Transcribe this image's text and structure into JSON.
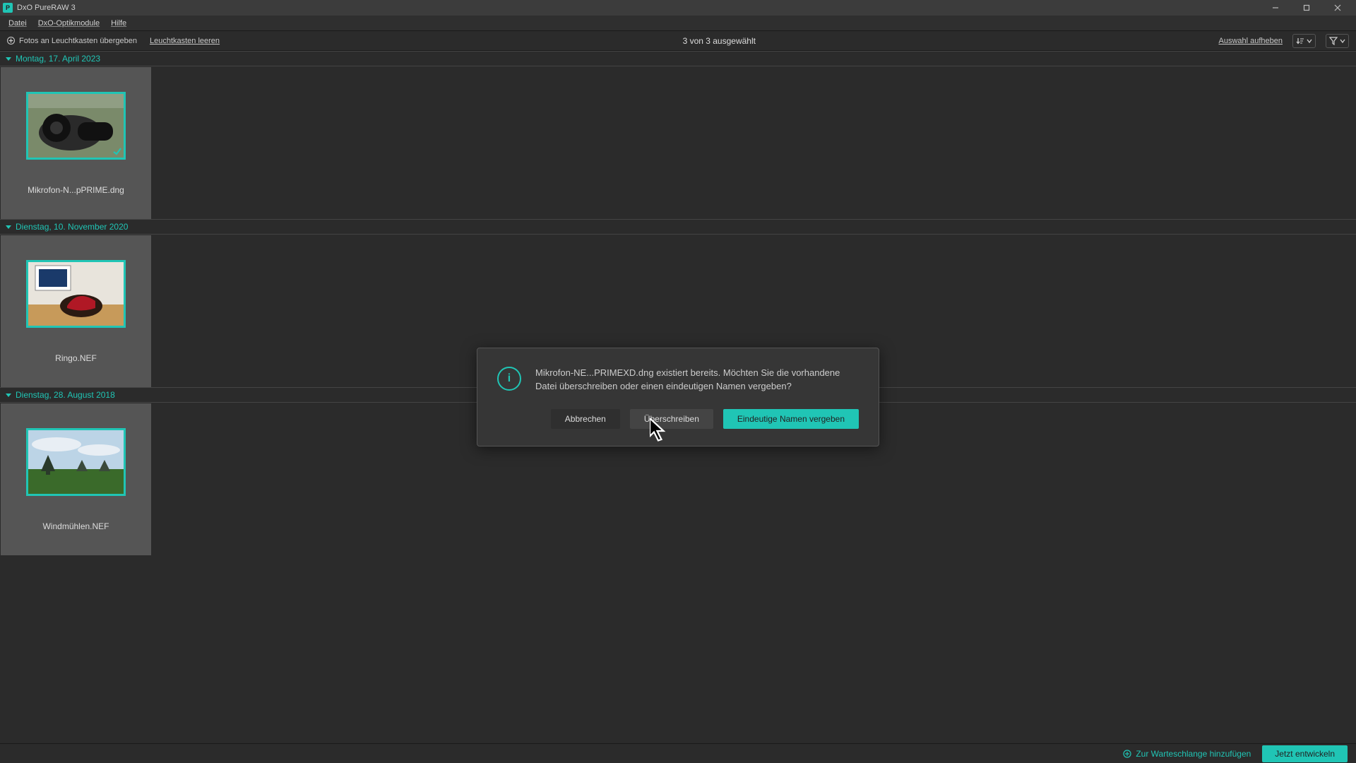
{
  "titlebar": {
    "title": "DxO PureRAW 3"
  },
  "menubar": {
    "file": "Datei",
    "modules": "DxO-Optikmodule",
    "help": "Hilfe"
  },
  "toolbar": {
    "add_photos": "Fotos an Leuchtkasten übergeben",
    "clear_lightbox": "Leuchtkasten leeren",
    "selection_status": "3 von 3 ausgewählt",
    "clear_selection": "Auswahl aufheben"
  },
  "groups": [
    {
      "date": "Montag, 17. April 2023",
      "items": [
        {
          "filename": "Mikrofon-N...pPRIME.dng"
        }
      ]
    },
    {
      "date": "Dienstag, 10. November 2020",
      "items": [
        {
          "filename": "Ringo.NEF"
        }
      ]
    },
    {
      "date": "Dienstag, 28. August 2018",
      "items": [
        {
          "filename": "Windmühlen.NEF"
        }
      ]
    }
  ],
  "dialog": {
    "message": "Mikrofon-NE...PRIMEXD.dng existiert bereits. Möchten Sie die vorhandene Datei überschreiben oder einen eindeutigen Namen vergeben?",
    "cancel": "Abbrechen",
    "overwrite": "Überschreiben",
    "unique": "Eindeutige Namen vergeben"
  },
  "footer": {
    "add_queue": "Zur Warteschlange hinzufügen",
    "develop": "Jetzt entwickeln"
  }
}
